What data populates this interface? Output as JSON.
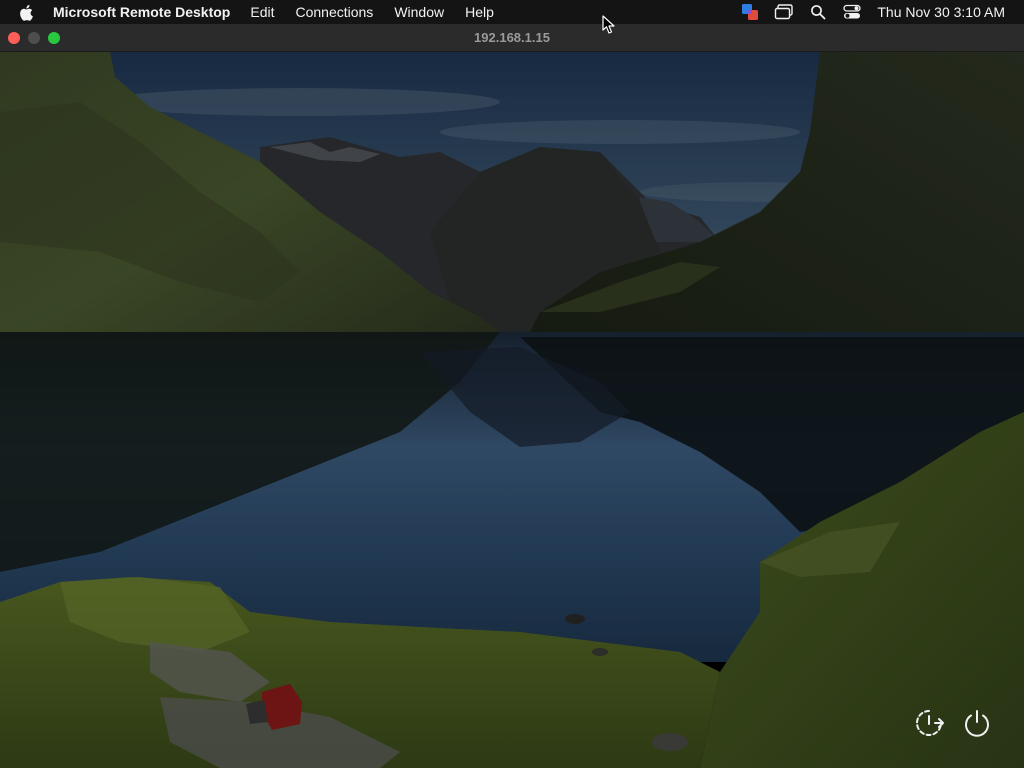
{
  "menubar": {
    "apple_icon": "apple-logo-icon",
    "app_name": "Microsoft Remote Desktop",
    "items": [
      "Edit",
      "Connections",
      "Window",
      "Help"
    ],
    "status_icons": [
      "remote-desktop-status-icon",
      "screens-icon",
      "search-icon",
      "control-center-icon"
    ],
    "clock": "Thu Nov 30  3:10 AM"
  },
  "window": {
    "title": "192.168.1.15",
    "buttons": [
      "close",
      "minimize",
      "zoom"
    ]
  },
  "desktop": {
    "wallpaper": "mountain-lake-landscape",
    "controls": {
      "restart_icon": "restart-icon",
      "power_icon": "power-icon"
    }
  },
  "colors": {
    "menubar_bg": "#141414",
    "titlebar_bg": "#2b2b2b",
    "close": "#ff5f57",
    "minimize": "#4e4e4e",
    "zoom": "#28c840",
    "accent_remote": "#2f7de1"
  }
}
